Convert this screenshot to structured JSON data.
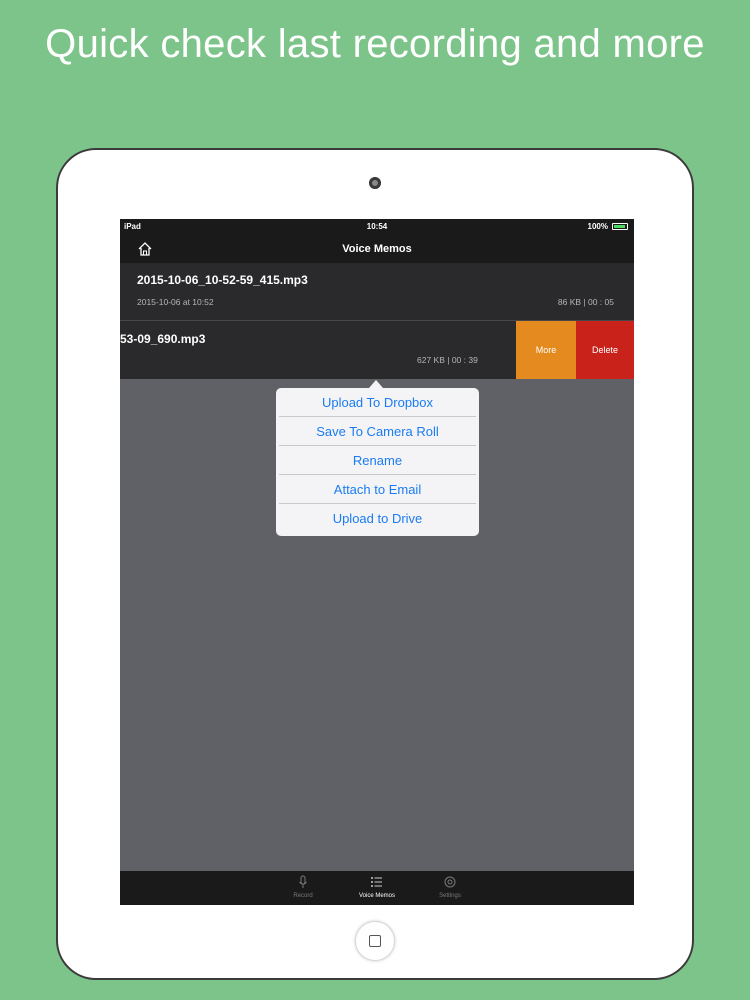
{
  "banner": {
    "text": "Quick check last recording and more"
  },
  "status_bar": {
    "device": "iPad",
    "time": "10:54",
    "battery": "100%"
  },
  "nav": {
    "title": "Voice Memos",
    "home_icon": "home-icon"
  },
  "recordings": [
    {
      "name": "2015-10-06_10-52-59_415.mp3",
      "date": "2015-10-06 at 10:52",
      "meta": "86 KB | 00 : 05"
    },
    {
      "name": "53-09_690.mp3",
      "meta": "627 KB | 00 : 39"
    }
  ],
  "swipe_actions": {
    "more": "More",
    "delete": "Delete",
    "more_color": "#e58a1f",
    "delete_color": "#c9221a"
  },
  "popover_menu": [
    {
      "label": "Upload To Dropbox"
    },
    {
      "label": "Save To Camera Roll"
    },
    {
      "label": "Rename"
    },
    {
      "label": "Attach to Email"
    },
    {
      "label": "Upload to Drive"
    }
  ],
  "tabs": [
    {
      "label": "Record",
      "icon": "microphone-icon",
      "active": false
    },
    {
      "label": "Voice Memos",
      "icon": "list-icon",
      "active": true
    },
    {
      "label": "Settings",
      "icon": "gear-icon",
      "active": false
    }
  ],
  "colors": {
    "background": "#7dc48a",
    "accent": "#1a7cf2"
  }
}
